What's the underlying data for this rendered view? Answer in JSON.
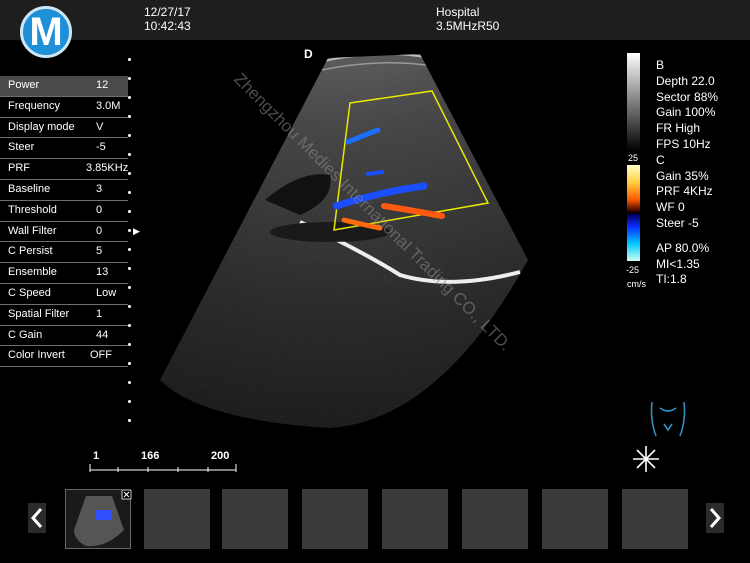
{
  "header": {
    "logo_letter": "M",
    "date": "12/27/17",
    "time": "10:42:43",
    "hospital": "Hospital",
    "probe": "3.5MHzR50",
    "orientation_marker": "D"
  },
  "params": [
    {
      "label": "Power",
      "value": "12"
    },
    {
      "label": "Frequency",
      "value": "3.0M"
    },
    {
      "label": "Display mode",
      "value": "V"
    },
    {
      "label": "Steer",
      "value": "-5"
    },
    {
      "label": "PRF",
      "value": "3.85KHz"
    },
    {
      "label": "Baseline",
      "value": "3"
    },
    {
      "label": "Threshold",
      "value": "0"
    },
    {
      "label": "Wall Filter",
      "value": "0"
    },
    {
      "label": "C Persist",
      "value": "5"
    },
    {
      "label": "Ensemble",
      "value": "13"
    },
    {
      "label": "C Speed",
      "value": "Low"
    },
    {
      "label": "Spatial Filter",
      "value": "1"
    },
    {
      "label": "C Gain",
      "value": "44"
    },
    {
      "label": "Color Invert",
      "value": "OFF"
    }
  ],
  "right_panel": {
    "b_lines": [
      "B",
      "Depth 22.0",
      "Sector 88%",
      "Gain 100%",
      "FR High",
      "FPS 10Hz"
    ],
    "c_lines": [
      "C",
      "Gain  35%",
      "PRF 4KHz",
      "WF 0"
    ],
    "steer": "Steer -5",
    "out_lines": [
      "AP 80.0%",
      "MI<1.35",
      "TI:1.8"
    ],
    "color_scale_top": "25",
    "color_scale_bottom": "-25",
    "color_scale_unit": "cm/s"
  },
  "scale": {
    "labels": [
      "1",
      "166",
      "200"
    ]
  },
  "watermark": "Zhengzhou Medies International Trading CO., LTD.",
  "colors": {
    "accent_logo": "#1f8fd8",
    "color_box": "#e8e800",
    "panel_bg": "#1e1e1e"
  }
}
